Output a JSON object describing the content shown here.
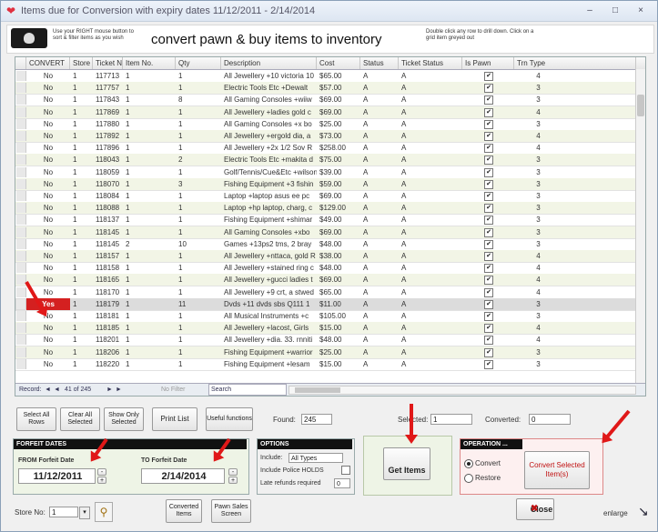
{
  "window": {
    "title": "Items due for Conversion with expiry dates 11/12/2011 - 2/14/2014",
    "minimize": "–",
    "restore": "□",
    "close": "×"
  },
  "header": {
    "tip_left": "Use your RIGHT mouse button to sort & filter items as you wish",
    "title": "convert pawn & buy items to inventory",
    "tip_right": "Double click any row to drill down. Click on a grid item greyed out"
  },
  "grid": {
    "columns": [
      "CONVERT",
      "Store",
      "Ticket No.",
      "Item No.",
      "Qty",
      "Description",
      "Cost",
      "Status",
      "Ticket Status",
      "Is Pawn",
      "Trn Type"
    ],
    "rows": [
      [
        "No",
        "1",
        "117713",
        "1",
        "1",
        "All Jewellery +10 victoria 10",
        "$65.00",
        "A",
        "A",
        "4"
      ],
      [
        "No",
        "1",
        "117757",
        "1",
        "1",
        "Electric Tools Etc +Dewalt",
        "$57.00",
        "A",
        "A",
        "3"
      ],
      [
        "No",
        "1",
        "117843",
        "1",
        "8",
        "All Gaming Consoles +wiiw",
        "$69.00",
        "A",
        "A",
        "3"
      ],
      [
        "No",
        "1",
        "117869",
        "1",
        "1",
        "All Jewellery +ladies gold c",
        "$69.00",
        "A",
        "A",
        "4"
      ],
      [
        "No",
        "1",
        "117880",
        "1",
        "1",
        "All Gaming Consoles +x bo",
        "$25.00",
        "A",
        "A",
        "3"
      ],
      [
        "No",
        "1",
        "117892",
        "1",
        "1",
        "All Jewellery +ergold dia, a",
        "$73.00",
        "A",
        "A",
        "4"
      ],
      [
        "No",
        "1",
        "117896",
        "1",
        "1",
        "All Jewellery +2x 1/2 Sov R",
        "$258.00",
        "A",
        "A",
        "4"
      ],
      [
        "No",
        "1",
        "118043",
        "1",
        "2",
        "Electric Tools Etc +makita d",
        "$75.00",
        "A",
        "A",
        "3"
      ],
      [
        "No",
        "1",
        "118059",
        "1",
        "1",
        "Golf/Tennis/Cue&Etc +wilson",
        "$39.00",
        "A",
        "A",
        "3"
      ],
      [
        "No",
        "1",
        "118070",
        "1",
        "3",
        "Fishing Equipment +3 fishin",
        "$59.00",
        "A",
        "A",
        "3"
      ],
      [
        "No",
        "1",
        "118084",
        "1",
        "1",
        "Laptop +laptop asus ee pc",
        "$69.00",
        "A",
        "A",
        "3"
      ],
      [
        "No",
        "1",
        "118088",
        "1",
        "1",
        "Laptop +hp laptop, charg, c",
        "$129.00",
        "A",
        "A",
        "3"
      ],
      [
        "No",
        "1",
        "118137",
        "1",
        "1",
        "Fishing Equipment +shimar",
        "$49.00",
        "A",
        "A",
        "3"
      ],
      [
        "No",
        "1",
        "118145",
        "1",
        "1",
        "All Gaming Consoles +xbo",
        "$69.00",
        "A",
        "A",
        "3"
      ],
      [
        "No",
        "1",
        "118145",
        "2",
        "10",
        "Games +13ps2 tms, 2 bray",
        "$48.00",
        "A",
        "A",
        "3"
      ],
      [
        "No",
        "1",
        "118157",
        "1",
        "1",
        "All Jewellery +nttaca, gold R",
        "$38.00",
        "A",
        "A",
        "4"
      ],
      [
        "No",
        "1",
        "118158",
        "1",
        "1",
        "All Jewellery +stained ring c",
        "$48.00",
        "A",
        "A",
        "4"
      ],
      [
        "No",
        "1",
        "118165",
        "1",
        "1",
        "All Jewellery +gucci ladies t",
        "$69.00",
        "A",
        "A",
        "4"
      ],
      [
        "No",
        "1",
        "118170",
        "1",
        "1",
        "All Jewellery +9 crt, a stwed",
        "$65.00",
        "A",
        "A",
        "4"
      ],
      [
        "Yes",
        "1",
        "118179",
        "1",
        "11",
        "Dvds +11 dvds sbs Q111 1",
        "$11.00",
        "A",
        "A",
        "3"
      ],
      [
        "No",
        "1",
        "118181",
        "1",
        "1",
        "All Musical Instruments +c",
        "$105.00",
        "A",
        "A",
        "3"
      ],
      [
        "No",
        "1",
        "118185",
        "1",
        "1",
        "All Jewellery +lacost, Girls",
        "$15.00",
        "A",
        "A",
        "4"
      ],
      [
        "No",
        "1",
        "118201",
        "1",
        "1",
        "All Jewellery +dia. 33. rnniti",
        "$48.00",
        "A",
        "A",
        "4"
      ],
      [
        "No",
        "1",
        "118206",
        "1",
        "1",
        "Fishing Equipment +warrior",
        "$25.00",
        "A",
        "A",
        "3"
      ],
      [
        "No",
        "1",
        "118220",
        "1",
        "1",
        "Fishing Equipment +lesam",
        "$15.00",
        "A",
        "A",
        "3"
      ]
    ],
    "nav": {
      "record_label": "Record:",
      "first": "◄",
      "prev": "◄",
      "position": "41 of 245",
      "next": "►",
      "last": "►",
      "filter": "No Filter",
      "search": "Search"
    }
  },
  "buttons": {
    "select_all": "Select All Rows",
    "clear_all": "Clear All Selected",
    "show_only": "Show Only Selected",
    "print_list": "Print List",
    "useful_functions": "Useful functions"
  },
  "counts": {
    "found_label": "Found:",
    "found": "245",
    "selected_label": "Selected:",
    "selected": "1",
    "converted_label": "Converted:",
    "converted": "0"
  },
  "forfeit": {
    "heading": "FORFEIT DATES",
    "from_label": "FROM Forfeit Date",
    "from_value": "11/12/2011",
    "to_label": "TO Forfeit Date",
    "to_value": "2/14/2014",
    "minus": "-",
    "plus": "+"
  },
  "options": {
    "heading": "OPTIONS",
    "include_label": "Include:",
    "include_value": "All Types",
    "police_label": "Include Police HOLDS",
    "late_label": "Late refunds required",
    "late_value": "0"
  },
  "get_items": "Get Items",
  "operation": {
    "heading": "OPERATION ...",
    "convert": "Convert",
    "restore": "Restore",
    "convert_selected": "Convert Selected Item(s)"
  },
  "footer": {
    "store_label": "Store No:",
    "store_value": "1",
    "converted_items": "Converted Items",
    "pawn_sales": "Pawn Sales Screen",
    "close": "Close",
    "enlarge": "enlarge"
  },
  "colors": {
    "accent_red": "#e01818",
    "row_alt": "#f2f5e6",
    "yes_bg": "#d42020"
  }
}
